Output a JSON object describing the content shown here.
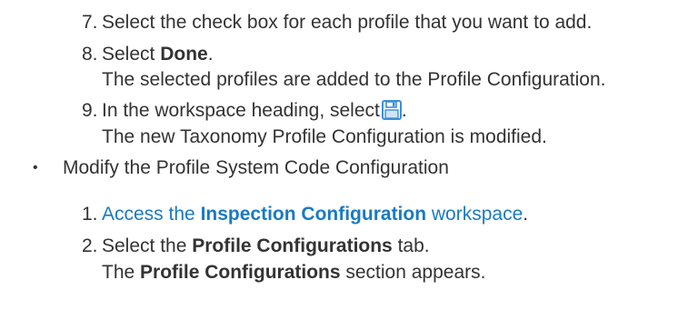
{
  "steps_top": [
    {
      "number": "7.",
      "text": "Select the check box for each profile that you want to add."
    },
    {
      "number": "8.",
      "prefix": "Select ",
      "bold": "Done",
      "suffix": ".",
      "result": "The selected profiles are added to the Profile Configuration."
    },
    {
      "number": "9.",
      "prefix": "In the workspace heading, select",
      "suffix": ".",
      "icon": "save-icon",
      "result": "The new Taxonomy Profile Configuration is modified."
    }
  ],
  "bullet": {
    "glyph": "•",
    "text": "Modify the Profile System Code Configuration"
  },
  "steps_bottom": [
    {
      "number": "1.",
      "link_prefix": "Access the ",
      "link_bold": "Inspection Configuration",
      "link_suffix": " workspace",
      "suffix": "."
    },
    {
      "number": "2.",
      "prefix": "Select the ",
      "bold": "Profile Configurations",
      "suffix": " tab.",
      "result_bold": "Profile Configurations",
      "result_suffix": " section appears.",
      "result_prefix": "The "
    }
  ],
  "colors": {
    "text": "#333333",
    "link": "#1a7ac2",
    "icon": "#3d8fd6"
  }
}
